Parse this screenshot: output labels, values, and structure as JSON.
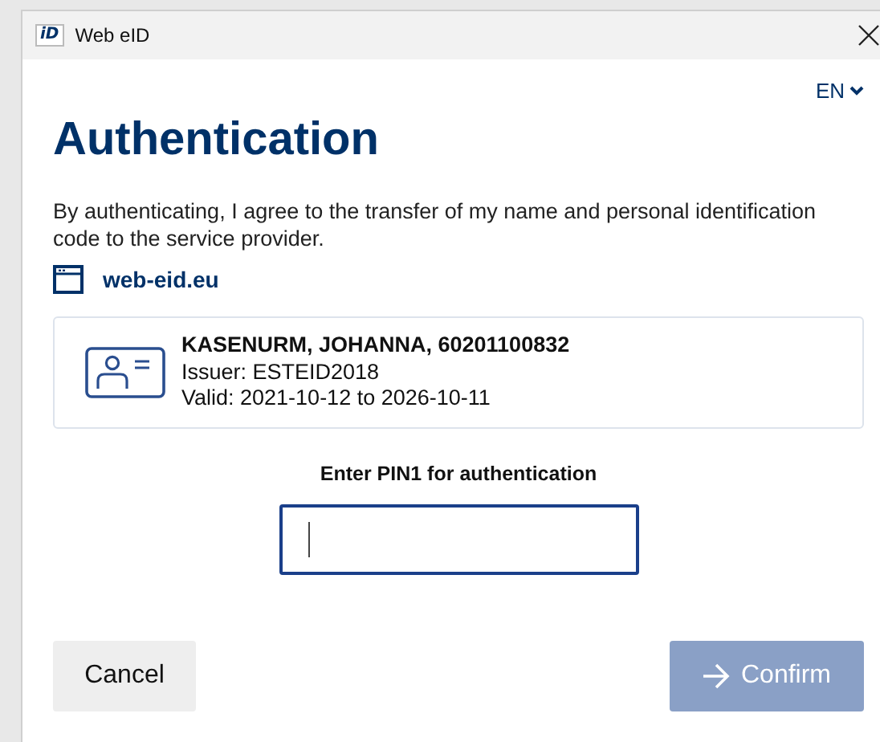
{
  "window": {
    "logo": "iD",
    "title": "Web eID"
  },
  "language": {
    "label": "EN"
  },
  "heading": "Authentication",
  "consent_text": "By authenticating, I agree to the transfer of my name and personal identification code to the service provider.",
  "origin": {
    "label": "web-eid.eu"
  },
  "certificate": {
    "holder": "KASENURM, JOHANNA, 60201100832",
    "issuer": "Issuer: ESTEID2018",
    "validity": "Valid: 2021-10-12 to 2026-10-11"
  },
  "pin": {
    "label": "Enter PIN1 for authentication",
    "focused": true
  },
  "buttons": [
    {
      "kind": "cancel",
      "label": "Cancel",
      "disabled": false
    },
    {
      "kind": "confirm",
      "label": "Confirm",
      "disabled": true
    }
  ]
}
